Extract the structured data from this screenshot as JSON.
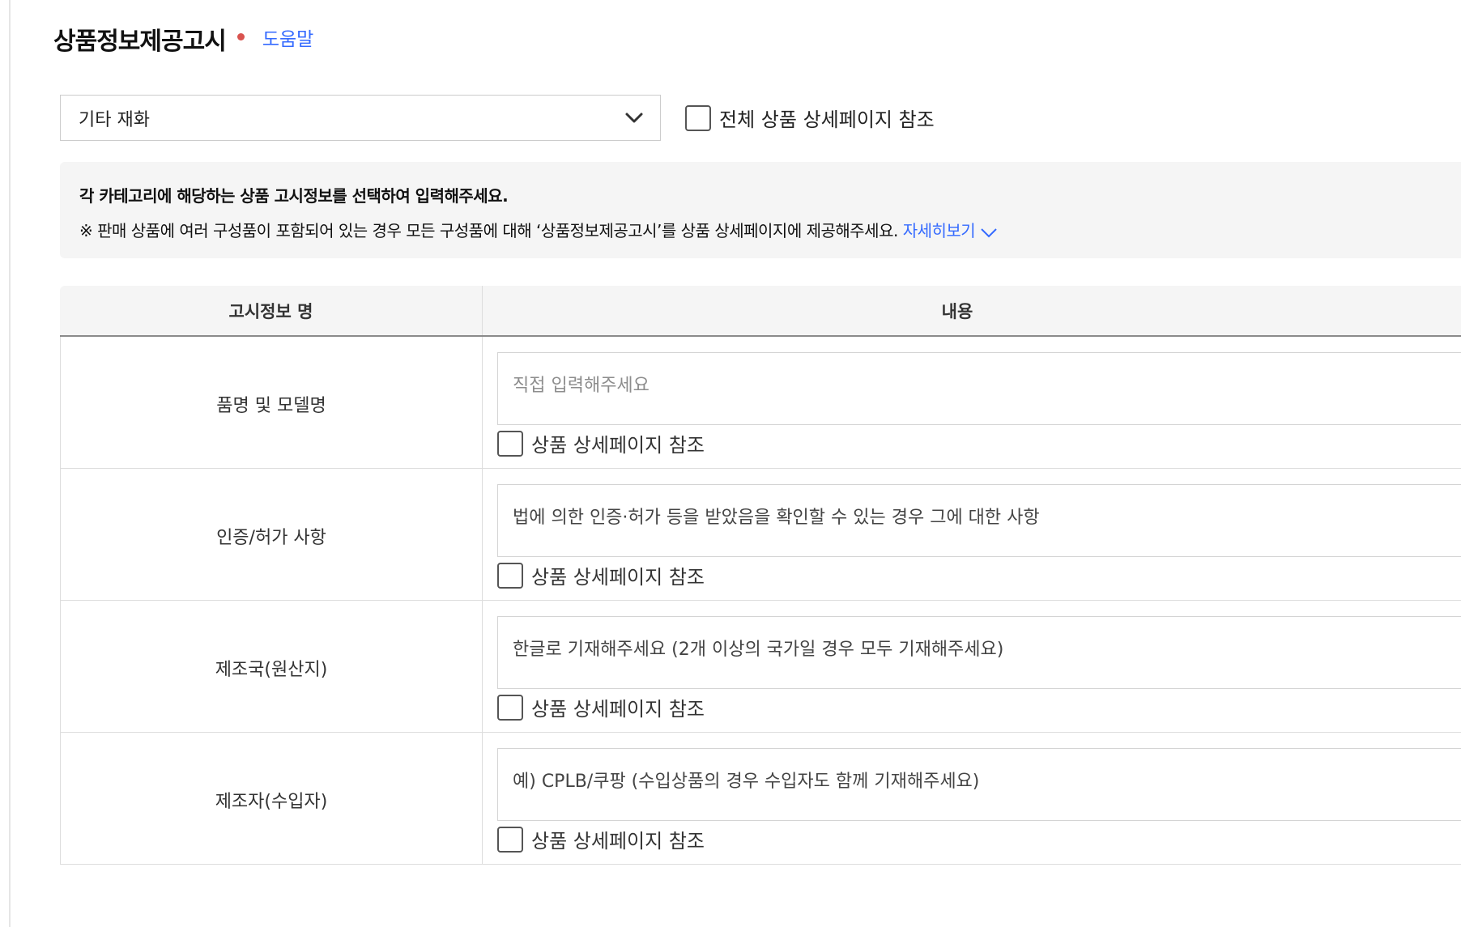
{
  "header": {
    "title": "상품정보제공고시",
    "help_label": "도움말"
  },
  "category_select": {
    "value": "기타 재화",
    "icon": "chevron-down-icon"
  },
  "all_reference": {
    "label": "전체 상품 상세페이지 참조",
    "checked": false
  },
  "notice": {
    "heading": "각 카테고리에 해당하는 상품 고시정보를 선택하여 입력해주세요.",
    "line": "※ 판매 상품에 여러 구성품이 포함되어 있는 경우 모든 구성품에 대해 ‘상품정보제공고시’를 상품 상세페이지에 제공해주세요.",
    "more_label": "자세히보기"
  },
  "table": {
    "headers": [
      "고시정보 명",
      "내용"
    ],
    "rows": [
      {
        "name": "품명 및 모델명",
        "placeholder": "직접 입력해주세요",
        "value": "",
        "ref_label": "상품 상세페이지 참조"
      },
      {
        "name": "인증/허가 사항",
        "placeholder": "",
        "value": "법에 의한 인증·허가 등을 받았음을 확인할 수 있는 경우 그에 대한 사항",
        "ref_label": "상품 상세페이지 참조"
      },
      {
        "name": "제조국(원산지)",
        "placeholder": "",
        "value": "한글로 기재해주세요 (2개 이상의 국가일 경우 모두 기재해주세요)",
        "ref_label": "상품 상세페이지 참조"
      },
      {
        "name": "제조자(수입자)",
        "placeholder": "",
        "value": "예) CPLB/쿠팡 (수입상품의 경우 수입자도 함께 기재해주세요)",
        "ref_label": "상품 상세페이지 참조"
      }
    ]
  },
  "colors": {
    "accent": "#346aff",
    "required": "#d9534f"
  }
}
